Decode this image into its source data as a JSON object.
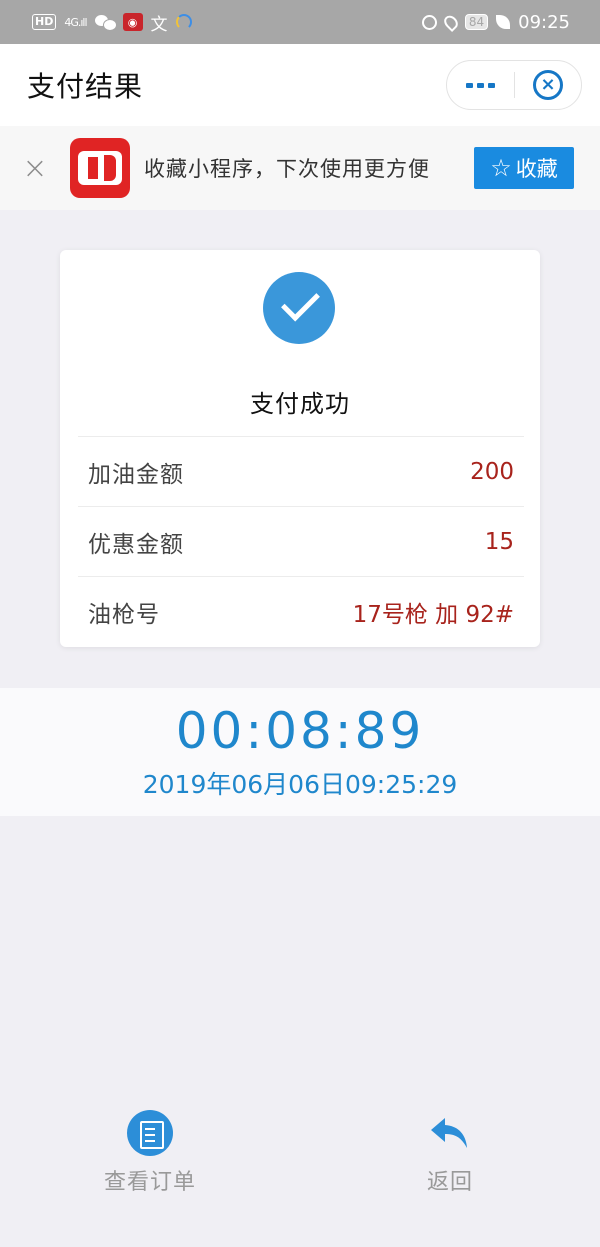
{
  "status_bar": {
    "hd": "HD",
    "network": "4G",
    "wen_icon": "文",
    "battery": "84",
    "time": "09:25"
  },
  "nav": {
    "title": "支付结果",
    "close_glyph": "×"
  },
  "favorite_banner": {
    "close_glyph": "×",
    "text": "收藏小程序，下次使用更方便",
    "button_icon": "☆",
    "button_label": "收藏"
  },
  "payment": {
    "status": "支付成功",
    "rows": [
      {
        "label": "加油金额",
        "value": "200"
      },
      {
        "label": "优惠金额",
        "value": "15"
      },
      {
        "label": "油枪号",
        "value": "17号枪 加 92#"
      }
    ]
  },
  "timer": {
    "elapsed": "00:08:89",
    "datetime": "2019年06月06日09:25:29"
  },
  "actions": {
    "orders_label": "查看订单",
    "back_label": "返回"
  },
  "colors": {
    "accent_blue": "#1f87cc",
    "value_red": "#a8231c",
    "favorite_button": "#1a8be0"
  },
  "icons": {
    "success": "check-circle-icon",
    "orders": "clipboard-icon",
    "back": "reply-arrow-icon"
  }
}
